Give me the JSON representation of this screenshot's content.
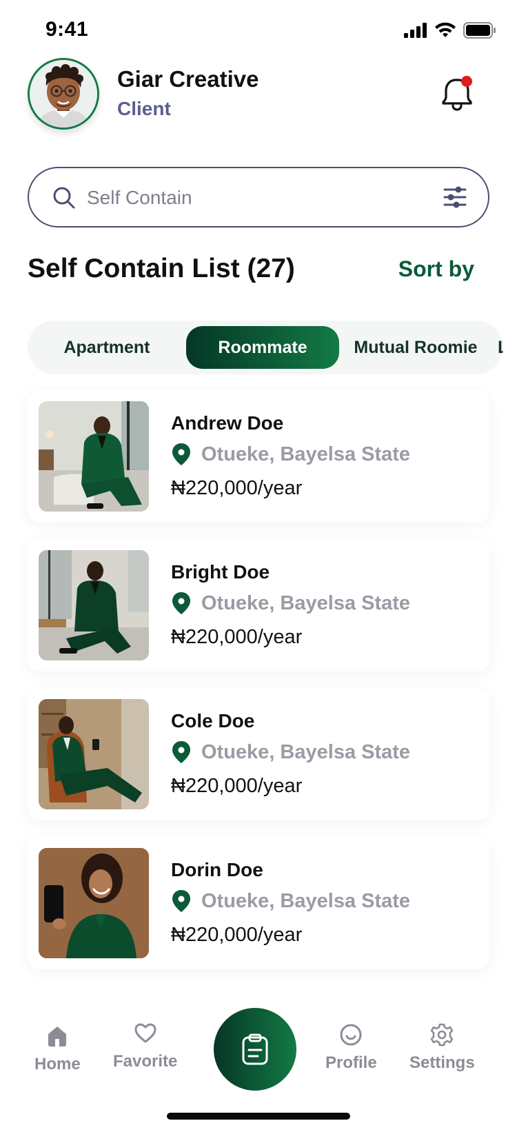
{
  "status_bar": {
    "time": "9:41",
    "icons": [
      "signal-icon",
      "wifi-icon",
      "battery-icon"
    ]
  },
  "header": {
    "user_name": "Giar Creative",
    "user_role": "Client",
    "avatar_icon": "avatar",
    "notification_icon": "bell-icon",
    "has_unread_notification": true
  },
  "search": {
    "placeholder": "Self Contain",
    "value": "",
    "icon": "search-icon",
    "filter_icon": "filter-sliders-icon"
  },
  "list": {
    "title": "Self Contain List (27)",
    "sort_label": "Sort by"
  },
  "tabs": [
    {
      "label": "Apartment",
      "active": false
    },
    {
      "label": "Roommate",
      "active": true
    },
    {
      "label": "Mutual Roomie",
      "active": false
    },
    {
      "label": "L",
      "active": false
    }
  ],
  "listings": [
    {
      "name": "Andrew Doe",
      "location": "Otueke, Bayelsa State",
      "price": "₦220,000/year"
    },
    {
      "name": "Bright Doe",
      "location": "Otueke, Bayelsa State",
      "price": "₦220,000/year"
    },
    {
      "name": "Cole Doe",
      "location": "Otueke, Bayelsa State",
      "price": "₦220,000/year"
    },
    {
      "name": "Dorin Doe",
      "location": "Otueke, Bayelsa State",
      "price": "₦220,000/year"
    }
  ],
  "bottom_nav": {
    "home": "Home",
    "favorite": "Favorite",
    "profile": "Profile",
    "settings": "Settings",
    "center_icon": "clipboard-icon"
  },
  "colors": {
    "brand_dark": "#053726",
    "brand": "#137a45",
    "accent_text": "#0b5a38",
    "role_text": "#5b5f8e",
    "muted_text": "#9a9ba4",
    "notification_dot": "#e01b1b"
  }
}
